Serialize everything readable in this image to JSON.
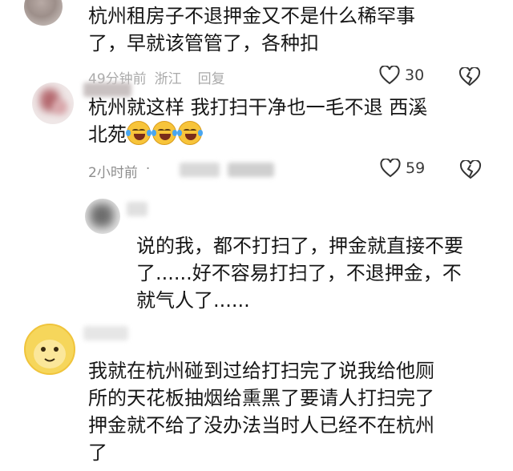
{
  "comments": [
    {
      "text_lines": [
        "杭州租房子不退押金又不是什么稀罕事",
        "了，早就该管管了，各种扣"
      ],
      "time": "49分钟前",
      "location": "浙江",
      "reply_label": "回复",
      "likes": "30",
      "avatar_color": "#a89b97"
    },
    {
      "text_lines": [
        "杭州就这样  我打扫干净也一毛不退  西溪",
        "北苑"
      ],
      "emojis": [
        "laughing-tears-emoji",
        "laughing-tears-emoji",
        "laughing-tears-emoji"
      ],
      "time": "2小时前",
      "likes": "59",
      "avatar_color": "#b56a70"
    },
    {
      "text_lines": [
        "说的我，都不打扫了，押金就直接不要",
        "了......好不容易打扫了，不退押金，不",
        "就气人了......"
      ],
      "avatar_color": "#6c6c6c"
    },
    {
      "text_lines": [
        "我就在杭州碰到过给打扫完了说我给他厕",
        "所的天花板抽烟给熏黑了要请人打扫完了",
        "押金就不给了没办法当时人已经不在杭州",
        "了"
      ],
      "avatar_color": "#f6d65b"
    }
  ],
  "icons": {
    "like": "heart-outline-icon",
    "dislike": "broken-heart-outline-icon"
  }
}
